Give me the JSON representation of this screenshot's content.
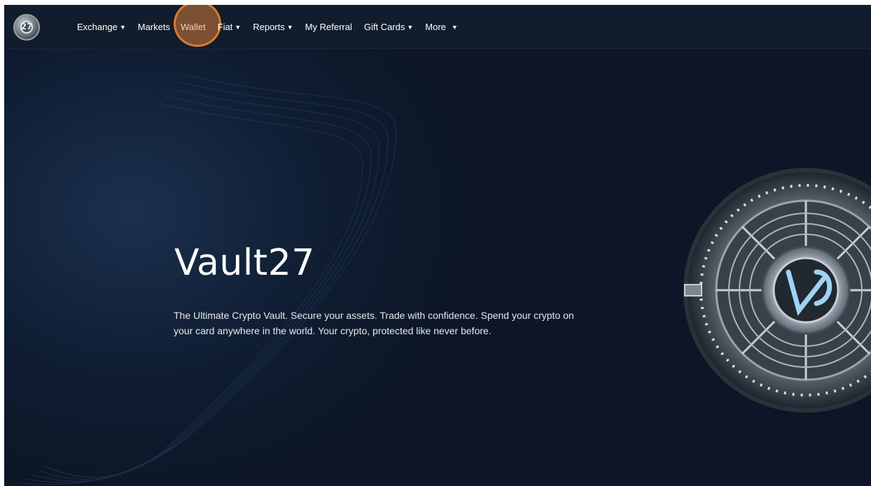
{
  "nav": {
    "logo_text": "27",
    "items": [
      {
        "label": "Exchange",
        "caret": "▼"
      },
      {
        "label": "Markets",
        "caret": ""
      },
      {
        "label": "Wallet",
        "caret": ""
      },
      {
        "label": "Fiat",
        "caret": "▼"
      },
      {
        "label": "Reports",
        "caret": "▼"
      },
      {
        "label": "My Referral",
        "caret": ""
      },
      {
        "label": "Gift Cards",
        "caret": "▼"
      },
      {
        "label": "More",
        "caret": "▼"
      }
    ],
    "active": "Wallet"
  },
  "hero": {
    "title": "Vault27",
    "description": "The Ultimate Crypto Vault. Secure your assets. Trade with confidence. Spend your crypto on your card anywhere in the world. Your crypto, protected like never before."
  },
  "colors": {
    "background": "#0c1626",
    "navbar": "#111d2c",
    "highlight": "#d97b2e"
  },
  "icons": {
    "logo": "vault27-logo-icon",
    "hero_image": "vault-door-icon"
  }
}
